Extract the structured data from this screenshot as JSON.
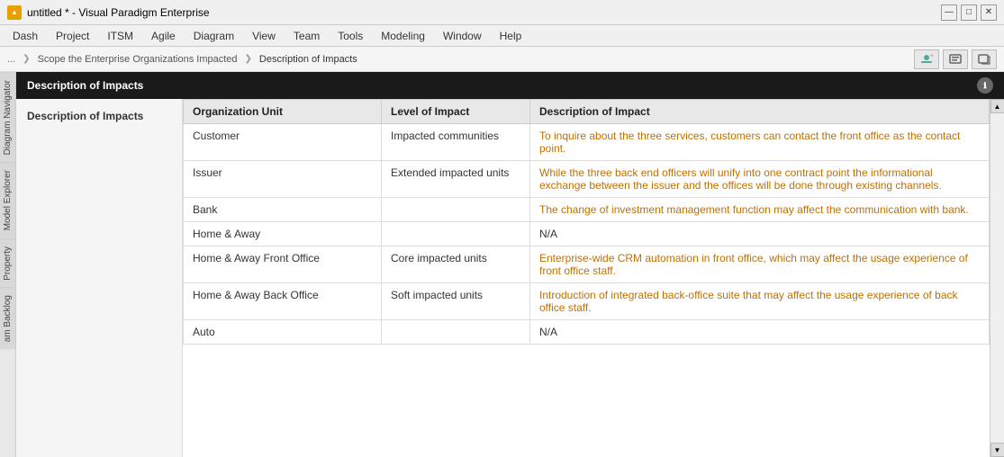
{
  "titleBar": {
    "title": "untitled * - Visual Paradigm Enterprise",
    "icon": "VP"
  },
  "menuBar": {
    "items": [
      "Dash",
      "Project",
      "ITSM",
      "Agile",
      "Diagram",
      "View",
      "Team",
      "Tools",
      "Modeling",
      "Window",
      "Help"
    ]
  },
  "breadcrumb": {
    "dots": "...",
    "items": [
      "Scope the Enterprise Organizations Impacted",
      "Description of Impacts"
    ]
  },
  "panel": {
    "title": "Description of Impacts",
    "leftLabel": "Description of Impacts"
  },
  "table": {
    "headers": [
      "Organization Unit",
      "Level of Impact",
      "Description of Impact"
    ],
    "rows": [
      {
        "org": "Customer",
        "level": "Impacted communities",
        "desc": "To inquire about the three services, customers can contact the front office as the contact point."
      },
      {
        "org": "Issuer",
        "level": "Extended impacted units",
        "desc": "While the three back end officers will unify into one contract point the informational exchange between the issuer and the offices will be done through existing channels."
      },
      {
        "org": "Bank",
        "level": "",
        "desc": "The change of investment management function may affect the communication with bank."
      },
      {
        "org": "Home & Away",
        "level": "",
        "desc": "N/A"
      },
      {
        "org": "Home & Away Front Office",
        "level": "Core impacted units",
        "desc": "Enterprise-wide CRM automation in front office, which may affect the usage experience of front office staff."
      },
      {
        "org": "Home & Away Back Office",
        "level": "Soft impacted units",
        "desc": "Introduction of integrated back-office suite that may affect the usage experience of back office staff."
      },
      {
        "org": "Auto",
        "level": "",
        "desc": "N/A"
      }
    ]
  },
  "leftTabs": [
    "Diagram Navigator",
    "Model Explorer",
    "Property",
    "am Backlog"
  ],
  "titleControls": {
    "minimize": "—",
    "maximize": "□",
    "close": "✕"
  }
}
